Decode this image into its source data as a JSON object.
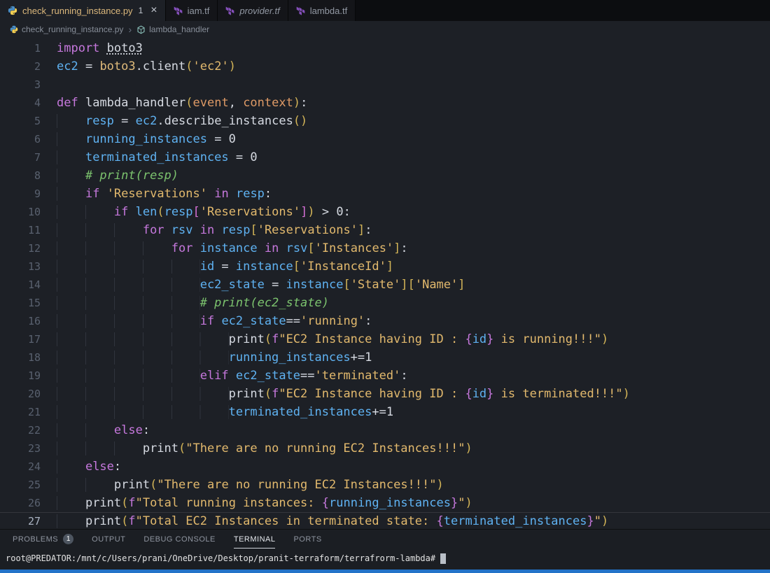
{
  "colors": {
    "modified_file_label": "#dcb87c",
    "keyword": "#c678dd",
    "string": "#e2b96d",
    "comment": "#7cc36e",
    "variable": "#5fb2f2",
    "parameter": "#de9a66",
    "terraform_brand": "#844fba",
    "python_blue": "#4a8fc7",
    "python_yellow": "#f7d154",
    "status_edge": "#2373c8"
  },
  "tabs": [
    {
      "label": "check_running_instance.py",
      "icon": "python",
      "badge": "1",
      "close": "×",
      "active": true,
      "italic": false
    },
    {
      "label": "iam.tf",
      "icon": "terraform",
      "active": false,
      "italic": false
    },
    {
      "label": "provider.tf",
      "icon": "terraform",
      "active": false,
      "italic": true
    },
    {
      "label": "lambda.tf",
      "icon": "terraform",
      "active": false,
      "italic": false
    }
  ],
  "breadcrumb": {
    "file": "check_running_instance.py",
    "separator": "›",
    "symbol": "lambda_handler"
  },
  "editor": {
    "lines": [
      {
        "num": "1",
        "tokens": [
          [
            "k",
            "import"
          ],
          [
            "w",
            " "
          ],
          [
            "u",
            "boto3"
          ]
        ]
      },
      {
        "num": "2",
        "tokens": [
          [
            "v",
            "ec2"
          ],
          [
            "w",
            " = "
          ],
          [
            "m",
            "boto3"
          ],
          [
            "w",
            ".client"
          ],
          [
            "b1",
            "("
          ],
          [
            "s",
            "'ec2'"
          ],
          [
            "b1",
            ")"
          ]
        ]
      },
      {
        "num": "3",
        "tokens": []
      },
      {
        "num": "4",
        "tokens": [
          [
            "k",
            "def"
          ],
          [
            "w",
            " "
          ],
          [
            "w",
            "lambda_handler"
          ],
          [
            "b1",
            "("
          ],
          [
            "p",
            "event"
          ],
          [
            "w",
            ", "
          ],
          [
            "p",
            "context"
          ],
          [
            "b1",
            ")"
          ],
          [
            "w",
            ":"
          ]
        ]
      },
      {
        "num": "5",
        "tokens": [
          [
            "i",
            "    "
          ],
          [
            "v",
            "resp"
          ],
          [
            "w",
            " = "
          ],
          [
            "v",
            "ec2"
          ],
          [
            "w",
            ".describe_instances"
          ],
          [
            "b1",
            "()"
          ]
        ]
      },
      {
        "num": "6",
        "tokens": [
          [
            "i",
            "    "
          ],
          [
            "v",
            "running_instances"
          ],
          [
            "w",
            " = "
          ],
          [
            "num",
            "0"
          ]
        ]
      },
      {
        "num": "7",
        "tokens": [
          [
            "i",
            "    "
          ],
          [
            "v",
            "terminated_instances"
          ],
          [
            "w",
            " = "
          ],
          [
            "num",
            "0"
          ]
        ]
      },
      {
        "num": "8",
        "tokens": [
          [
            "i",
            "    "
          ],
          [
            "c",
            "# print(resp)"
          ]
        ]
      },
      {
        "num": "9",
        "tokens": [
          [
            "i",
            "    "
          ],
          [
            "k",
            "if"
          ],
          [
            "w",
            " "
          ],
          [
            "s",
            "'Reservations'"
          ],
          [
            "w",
            " "
          ],
          [
            "k",
            "in"
          ],
          [
            "w",
            " "
          ],
          [
            "v",
            "resp"
          ],
          [
            "w",
            ":"
          ]
        ]
      },
      {
        "num": "10",
        "tokens": [
          [
            "i",
            "        "
          ],
          [
            "k",
            "if"
          ],
          [
            "w",
            " "
          ],
          [
            "v",
            "len"
          ],
          [
            "b1",
            "("
          ],
          [
            "v",
            "resp"
          ],
          [
            "b2",
            "["
          ],
          [
            "s",
            "'Reservations'"
          ],
          [
            "b2",
            "]"
          ],
          [
            "b1",
            ")"
          ],
          [
            "w",
            " > "
          ],
          [
            "num",
            "0"
          ],
          [
            "w",
            ":"
          ]
        ]
      },
      {
        "num": "11",
        "tokens": [
          [
            "i",
            "            "
          ],
          [
            "k",
            "for"
          ],
          [
            "w",
            " "
          ],
          [
            "v",
            "rsv"
          ],
          [
            "w",
            " "
          ],
          [
            "k",
            "in"
          ],
          [
            "w",
            " "
          ],
          [
            "v",
            "resp"
          ],
          [
            "b1",
            "["
          ],
          [
            "s",
            "'Reservations'"
          ],
          [
            "b1",
            "]"
          ],
          [
            "w",
            ":"
          ]
        ]
      },
      {
        "num": "12",
        "tokens": [
          [
            "i",
            "                "
          ],
          [
            "k",
            "for"
          ],
          [
            "w",
            " "
          ],
          [
            "v",
            "instance"
          ],
          [
            "w",
            " "
          ],
          [
            "k",
            "in"
          ],
          [
            "w",
            " "
          ],
          [
            "v",
            "rsv"
          ],
          [
            "b1",
            "["
          ],
          [
            "s",
            "'Instances'"
          ],
          [
            "b1",
            "]"
          ],
          [
            "w",
            ":"
          ]
        ]
      },
      {
        "num": "13",
        "tokens": [
          [
            "i",
            "                    "
          ],
          [
            "v",
            "id"
          ],
          [
            "w",
            " = "
          ],
          [
            "v",
            "instance"
          ],
          [
            "b1",
            "["
          ],
          [
            "s",
            "'InstanceId'"
          ],
          [
            "b1",
            "]"
          ]
        ]
      },
      {
        "num": "14",
        "tokens": [
          [
            "i",
            "                    "
          ],
          [
            "v",
            "ec2_state"
          ],
          [
            "w",
            " = "
          ],
          [
            "v",
            "instance"
          ],
          [
            "b1",
            "["
          ],
          [
            "s",
            "'State'"
          ],
          [
            "b1",
            "]"
          ],
          [
            "b1",
            "["
          ],
          [
            "s",
            "'Name'"
          ],
          [
            "b1",
            "]"
          ]
        ]
      },
      {
        "num": "15",
        "tokens": [
          [
            "i",
            "                    "
          ],
          [
            "c",
            "# print(ec2_state)"
          ]
        ]
      },
      {
        "num": "16",
        "tokens": [
          [
            "i",
            "                    "
          ],
          [
            "k",
            "if"
          ],
          [
            "w",
            " "
          ],
          [
            "v",
            "ec2_state"
          ],
          [
            "w",
            "=="
          ],
          [
            "s",
            "'running'"
          ],
          [
            "w",
            ":"
          ]
        ]
      },
      {
        "num": "17",
        "tokens": [
          [
            "i",
            "                        "
          ],
          [
            "w",
            "print"
          ],
          [
            "b1",
            "("
          ],
          [
            "k",
            "f"
          ],
          [
            "s",
            "\"EC2 Instance having ID : "
          ],
          [
            "k",
            "{"
          ],
          [
            "v",
            "id"
          ],
          [
            "k",
            "}"
          ],
          [
            "s",
            " is running!!!\""
          ],
          [
            "b1",
            ")"
          ]
        ]
      },
      {
        "num": "18",
        "tokens": [
          [
            "i",
            "                        "
          ],
          [
            "v",
            "running_instances"
          ],
          [
            "w",
            "+="
          ],
          [
            "num",
            "1"
          ]
        ]
      },
      {
        "num": "19",
        "tokens": [
          [
            "i",
            "                    "
          ],
          [
            "k",
            "elif"
          ],
          [
            "w",
            " "
          ],
          [
            "v",
            "ec2_state"
          ],
          [
            "w",
            "=="
          ],
          [
            "s",
            "'terminated'"
          ],
          [
            "w",
            ":"
          ]
        ]
      },
      {
        "num": "20",
        "tokens": [
          [
            "i",
            "                        "
          ],
          [
            "w",
            "print"
          ],
          [
            "b1",
            "("
          ],
          [
            "k",
            "f"
          ],
          [
            "s",
            "\"EC2 Instance having ID : "
          ],
          [
            "k",
            "{"
          ],
          [
            "v",
            "id"
          ],
          [
            "k",
            "}"
          ],
          [
            "s",
            " is terminated!!!\""
          ],
          [
            "b1",
            ")"
          ]
        ]
      },
      {
        "num": "21",
        "tokens": [
          [
            "i",
            "                        "
          ],
          [
            "v",
            "terminated_instances"
          ],
          [
            "w",
            "+="
          ],
          [
            "num",
            "1"
          ]
        ]
      },
      {
        "num": "22",
        "tokens": [
          [
            "i",
            "        "
          ],
          [
            "k",
            "else"
          ],
          [
            "w",
            ":"
          ]
        ]
      },
      {
        "num": "23",
        "tokens": [
          [
            "i",
            "            "
          ],
          [
            "w",
            "print"
          ],
          [
            "b1",
            "("
          ],
          [
            "s",
            "\"There are no running EC2 Instances!!!\""
          ],
          [
            "b1",
            ")"
          ]
        ]
      },
      {
        "num": "24",
        "tokens": [
          [
            "i",
            "    "
          ],
          [
            "k",
            "else"
          ],
          [
            "w",
            ":"
          ]
        ]
      },
      {
        "num": "25",
        "tokens": [
          [
            "i",
            "        "
          ],
          [
            "w",
            "print"
          ],
          [
            "b1",
            "("
          ],
          [
            "s",
            "\"There are no running EC2 Instances!!!\""
          ],
          [
            "b1",
            ")"
          ]
        ]
      },
      {
        "num": "26",
        "tokens": [
          [
            "i",
            "    "
          ],
          [
            "w",
            "print"
          ],
          [
            "b1",
            "("
          ],
          [
            "k",
            "f"
          ],
          [
            "s",
            "\"Total running instances: "
          ],
          [
            "k",
            "{"
          ],
          [
            "v",
            "running_instances"
          ],
          [
            "k",
            "}"
          ],
          [
            "s",
            "\""
          ],
          [
            "b1",
            ")"
          ]
        ]
      },
      {
        "num": "27",
        "current": true,
        "tokens": [
          [
            "i",
            "    "
          ],
          [
            "w",
            "print"
          ],
          [
            "b1",
            "("
          ],
          [
            "k",
            "f"
          ],
          [
            "s",
            "\"Total EC2 Instances in terminated state: "
          ],
          [
            "k",
            "{"
          ],
          [
            "v",
            "terminated_instances"
          ],
          [
            "k",
            "}"
          ],
          [
            "s",
            "\""
          ],
          [
            "b1",
            ")"
          ]
        ]
      }
    ]
  },
  "panel": {
    "tabs": [
      {
        "label": "PROBLEMS",
        "badge": "1",
        "active": false
      },
      {
        "label": "OUTPUT",
        "active": false
      },
      {
        "label": "DEBUG CONSOLE",
        "active": false
      },
      {
        "label": "TERMINAL",
        "active": true
      },
      {
        "label": "PORTS",
        "active": false
      }
    ],
    "terminal": {
      "prompt": "root@PREDATOR:/mnt/c/Users/prani/OneDrive/Desktop/pranit-terraform/terrafrorm-lambda#"
    }
  }
}
